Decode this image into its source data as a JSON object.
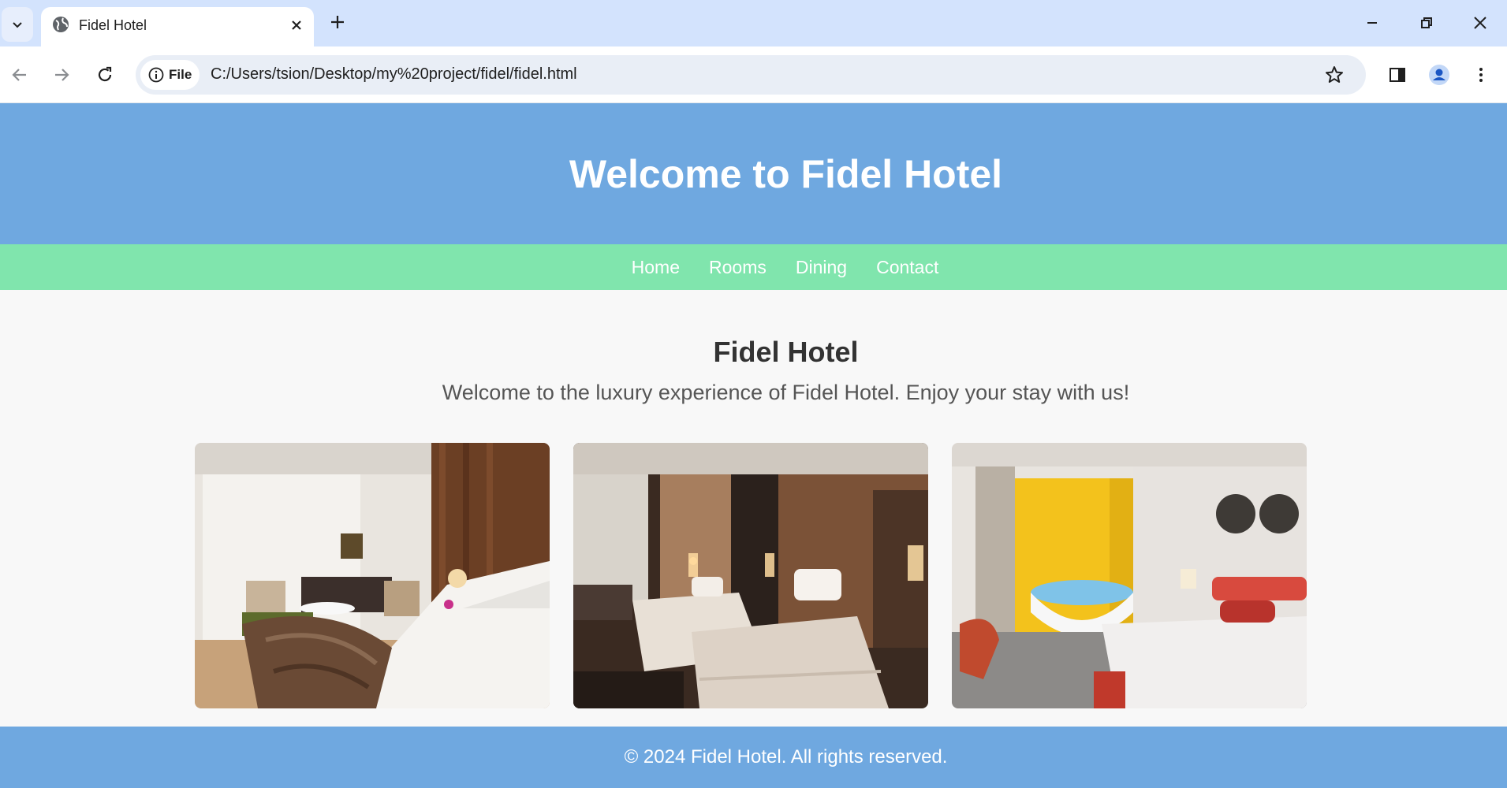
{
  "browser": {
    "tab_title": "Fidel Hotel",
    "chip_label": "File",
    "url": "C:/Users/tsion/Desktop/my%20project/fidel/fidel.html"
  },
  "site": {
    "header_title": "Welcome to Fidel Hotel",
    "nav": [
      "Home",
      "Rooms",
      "Dining",
      "Contact"
    ],
    "intro_title": "Fidel Hotel",
    "intro_text": "Welcome to the luxury experience of Fidel Hotel. Enjoy your stay with us!",
    "footer": "© 2024 Fidel Hotel. All rights reserved."
  },
  "colors": {
    "header_bg": "#6fa8e0",
    "nav_bg": "#80e5ad",
    "tabstrip_bg": "#d3e3fd"
  }
}
